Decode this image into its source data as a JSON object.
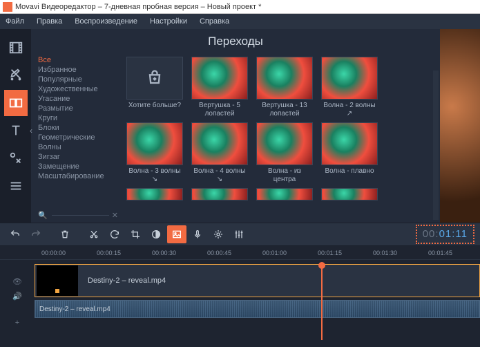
{
  "window": {
    "title": "Movavi Видеоредактор – 7-дневная пробная версия – Новый проект *"
  },
  "menu": [
    "Файл",
    "Правка",
    "Воспроизведение",
    "Настройки",
    "Справка"
  ],
  "panel": {
    "title": "Переходы",
    "categories": [
      "Все",
      "Избранное",
      "Популярные",
      "Художественные",
      "Угасание",
      "Размытие",
      "Круги",
      "Блоки",
      "Геометрические",
      "Волны",
      "Зигзаг",
      "Замещение",
      "Масштабирование"
    ],
    "active_category": "Все",
    "items_row1": [
      {
        "label": "Хотите больше?",
        "shop": true
      },
      {
        "label": "Вертушка - 5 лопастей"
      },
      {
        "label": "Вертушка - 13 лопастей"
      },
      {
        "label": "Волна - 2 волны ↗"
      }
    ],
    "items_row2": [
      {
        "label": "Волна - 3 волны ↘"
      },
      {
        "label": "Волна - 4 волны ↘"
      },
      {
        "label": "Волна - из центра"
      },
      {
        "label": "Волна - плавно"
      }
    ]
  },
  "timecode": {
    "hh": "00",
    "mm": "01",
    "ss": "11"
  },
  "ruler": [
    "00:00:00",
    "00:00:15",
    "00:00:30",
    "00:00:45",
    "00:01:00",
    "00:01:15",
    "00:01:30",
    "00:01:45"
  ],
  "tracks": {
    "video_clip": "Destiny-2 – reveal.mp4",
    "audio_clip": "Destiny-2 – reveal.mp4"
  }
}
